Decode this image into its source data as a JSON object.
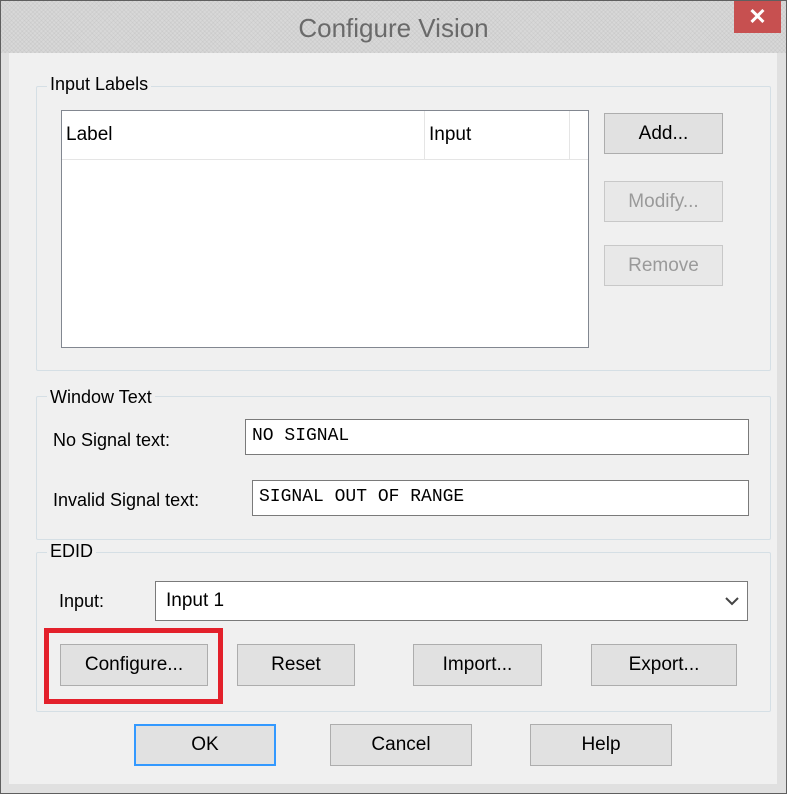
{
  "window": {
    "title": "Configure Vision",
    "close_glyph": "✕",
    "accent_close": "#c75050"
  },
  "input_labels": {
    "group_title": "Input Labels",
    "columns": [
      "Label",
      "Input"
    ],
    "rows": [],
    "buttons": {
      "add": "Add...",
      "modify": "Modify...",
      "remove": "Remove"
    }
  },
  "window_text": {
    "group_title": "Window Text",
    "no_signal_label": "No Signal text:",
    "no_signal_value": "NO SIGNAL",
    "invalid_signal_label": "Invalid Signal text:",
    "invalid_signal_value": "SIGNAL OUT OF RANGE"
  },
  "edid": {
    "group_title": "EDID",
    "input_label": "Input:",
    "input_selected": "Input 1",
    "buttons": {
      "configure": "Configure...",
      "reset": "Reset",
      "import": "Import...",
      "export": "Export..."
    },
    "highlight_color": "#e3202b"
  },
  "footer": {
    "ok": "OK",
    "cancel": "Cancel",
    "help": "Help"
  },
  "icons": {
    "close": "close-icon",
    "dropdown": "chevron-down-icon"
  }
}
